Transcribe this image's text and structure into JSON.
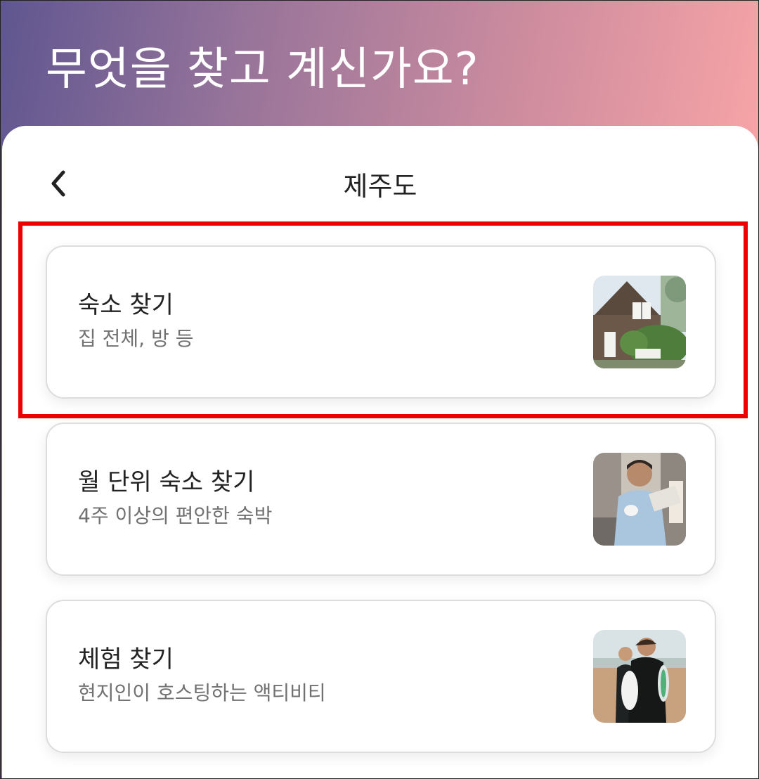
{
  "header": {
    "title": "무엇을 찾고 계신가요?",
    "gradient_colors": [
      "#5f5690",
      "#d18e9f",
      "#f9a5a5"
    ]
  },
  "nav": {
    "back_icon": "chevron-left-icon",
    "title": "제주도"
  },
  "options": [
    {
      "title": "숙소 찾기",
      "subtitle": "집 전체, 방 등",
      "thumbnail": "house-photo"
    },
    {
      "title": "월 단위 숙소 찾기",
      "subtitle": "4주 이상의 편안한 숙박",
      "thumbnail": "man-reading-photo"
    },
    {
      "title": "체험 찾기",
      "subtitle": "현지인이 호스팅하는 액티비티",
      "thumbnail": "surfers-photo"
    }
  ],
  "highlight": {
    "target": "options.0",
    "color": "#ee0000"
  }
}
